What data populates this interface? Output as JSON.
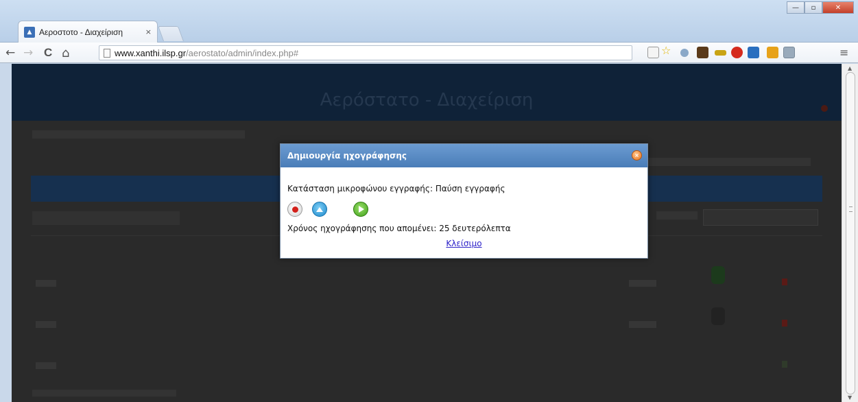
{
  "browser": {
    "tab_title": "Αεροστοτο - Διαχείριση",
    "tab_close": "×",
    "url_host": "www.xanthi.ilsp.gr",
    "url_path": "/aerostato/admin/index.php#",
    "back_glyph": "←",
    "forward_glyph": "→",
    "reload_glyph": "C",
    "home_glyph": "⌂",
    "menu_glyph": "≡",
    "window_buttons": {
      "minimize": "—",
      "maximize": "▫",
      "close": "✕"
    }
  },
  "background_page": {
    "site_title": "Αερόστατο - Διαχείριση"
  },
  "dialog": {
    "title": "Δημιουργία ηχογράφησης",
    "close_glyph": "×",
    "status_text": "Κατάσταση μικροφώνου εγγραφής: Παύση εγγραφής",
    "remaining_text": "Χρόνος ηχογράφησης που απομένει: 25 δευτερόλεπτα",
    "close_link": "Κλείσιμο"
  },
  "colors": {
    "dialog_titlebar": "#5a8cc6",
    "record_dot": "#d3201a",
    "upload_button": "#1c86c9",
    "play_button": "#3e9f18",
    "link": "#2a1fc8"
  }
}
